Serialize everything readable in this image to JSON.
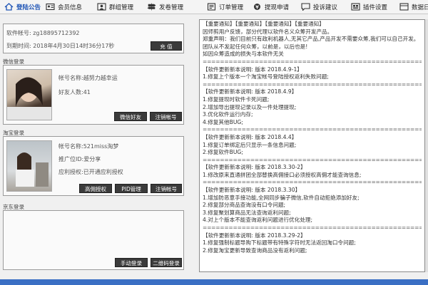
{
  "nav": [
    {
      "label": "登陆公告",
      "icon": "home-icon"
    },
    {
      "label": "会员信息",
      "icon": "id-card-icon"
    },
    {
      "label": "群组管理",
      "icon": "group-icon"
    },
    {
      "label": "发卷管理",
      "icon": "sign-icon"
    },
    {
      "label": "订单管理",
      "icon": "cart-icon"
    },
    {
      "label": "提现申请",
      "icon": "withdraw-icon"
    },
    {
      "label": "投诉建议",
      "icon": "complaint-icon"
    },
    {
      "label": "插件设置",
      "icon": "plugin-icon"
    },
    {
      "label": "数据日",
      "icon": "data-icon"
    }
  ],
  "account": {
    "software_account": "软件帐号: zg18895712392",
    "expiry": "到期时间: 2018年4月30日14时36分17秒",
    "recharge_button": "充  值"
  },
  "wechat": {
    "section_label": "微信登录",
    "account_name": "帐号名称:越努力越幸运",
    "friend_count": "好友人数:41",
    "friends_button": "微信好友",
    "logout_button": "注销帐号"
  },
  "taobao": {
    "section_label": "淘宝登录",
    "account_name": "帐号名称:521miss淘梦",
    "promo_id": "推广位ID:爱分享",
    "status": "应利授权:已开通应利授权",
    "auth_button": "高佣授权",
    "pid_button": "PID管理",
    "logout_button": "注销帐号"
  },
  "jd": {
    "section_label": "京东登录",
    "manual_button": "手动登录",
    "qr_button": "二维码登录"
  },
  "announce": [
    "【重要通知】【重要通知】【重要通知】【重要通知】",
    "  因师剪用户反馈，部分代理以软件名义众筹开发产品。",
    "  郑重声明：我们目前只有政利机器人,无其它产品,产品开发不需要众筹,我们可以自己开发。",
    "  团队从不发起任何众筹，以前是，以后也是!",
    "  如因众筹造成的损失与本软件无关",
    "  =======================================================",
    "【软件更新新本说明: 版本 2018.4.9-1】",
    "1.修复上个版本一个淘宝帐号登陆授权返利失败问题;",
    "=========================================================",
    "【软件更新新本说明: 版本 2018.4.9】",
    "1.修复提现时软件卡死问题;",
    "2.增加导出提现记录以及一件处理提现;",
    "3.优化软件运行内存;",
    "4.修复其他BUG;",
    "=========================================================",
    "【软件更新新本说明: 版本 2018.4.4】",
    "1.修复订单绑定后只显示一条信息问题;",
    "2.修复软件BUG;",
    "=========================================================",
    "【软件更新新本说明: 版本 2018.3.30-2】",
    "1.修改原来直通拼团全部替换高佣接口必须授权高佣才能查询信息;",
    "=========================================================",
    "【软件更新新本说明: 版本 2018.3.30】",
    "1.增加防恶意手接功能,全网同步骗子微信,软件自动拒绝添加好友;",
    "2.修复部分商品查询没有口令问题;",
    "3.修复聚划算商品无法查询返利问题;",
    "4.对上个版本不能查询返利问题进行优化处理;",
    "=========================================================",
    "【软件更新新本说明: 版本 2018.3.29-2】",
    "1.修复强制标题导购下标题带有特殊字符时无法返回淘口令问题;",
    "2.修复淘宝更新导致查询商品没有返利问题;"
  ]
}
